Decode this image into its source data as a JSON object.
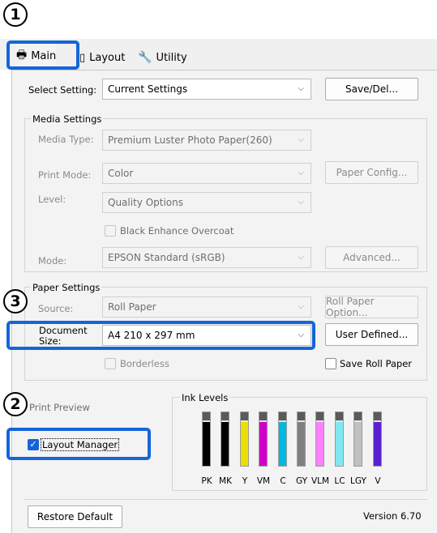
{
  "markers": {
    "m1": "1",
    "m2": "2",
    "m3": "3"
  },
  "tabs": [
    {
      "label": "Main",
      "icon": "printer-icon"
    },
    {
      "label": "Layout",
      "icon": "layout-icon"
    },
    {
      "label": "Utility",
      "icon": "wrench-icon"
    }
  ],
  "select_setting": {
    "label": "Select Setting:",
    "value": "Current Settings",
    "button": "Save/Del..."
  },
  "media": {
    "title": "Media Settings",
    "media_type_label": "Media Type:",
    "media_type_value": "Premium Luster Photo Paper(260)",
    "print_mode_label": "Print Mode:",
    "print_mode_value": "Color",
    "paper_config_button": "Paper Config...",
    "level_label": "Level:",
    "level_value": "Quality Options",
    "black_enhance_label": "Black Enhance Overcoat",
    "mode_label": "Mode:",
    "mode_value": "EPSON Standard (sRGB)",
    "advanced_button": "Advanced..."
  },
  "paper": {
    "title": "Paper Settings",
    "source_label": "Source:",
    "source_value": "Roll Paper",
    "roll_option_button": "Roll Paper Option...",
    "doc_size_label_1": "Document",
    "doc_size_label_2": "Size:",
    "doc_size_value": "A4 210 x 297 mm",
    "user_defined_button": "User Defined...",
    "borderless_label": "Borderless",
    "save_roll_label": "Save Roll Paper"
  },
  "print_preview_label": "Print Preview",
  "layout_manager_label": "Layout Manager",
  "ink": {
    "title": "Ink Levels",
    "cartridges": [
      {
        "label": "PK",
        "color": "#000000",
        "level": 0.82
      },
      {
        "label": "MK",
        "color": "#000000",
        "level": 0.82
      },
      {
        "label": "Y",
        "color": "#e8e000",
        "level": 0.82
      },
      {
        "label": "VM",
        "color": "#d000c8",
        "level": 0.82
      },
      {
        "label": "C",
        "color": "#00b8e0",
        "level": 0.82
      },
      {
        "label": "GY",
        "color": "#808080",
        "level": 0.82
      },
      {
        "label": "VLM",
        "color": "#ff80ff",
        "level": 0.82
      },
      {
        "label": "LC",
        "color": "#80e8f0",
        "level": 0.82
      },
      {
        "label": "LGY",
        "color": "#c0c0c0",
        "level": 0.82
      },
      {
        "label": "V",
        "color": "#5a20d0",
        "level": 0.82
      }
    ]
  },
  "restore_default_button": "Restore Default",
  "version": "Version 6.70",
  "colors": {
    "highlight": "#1565d8",
    "panel": "#f3f3f3"
  }
}
